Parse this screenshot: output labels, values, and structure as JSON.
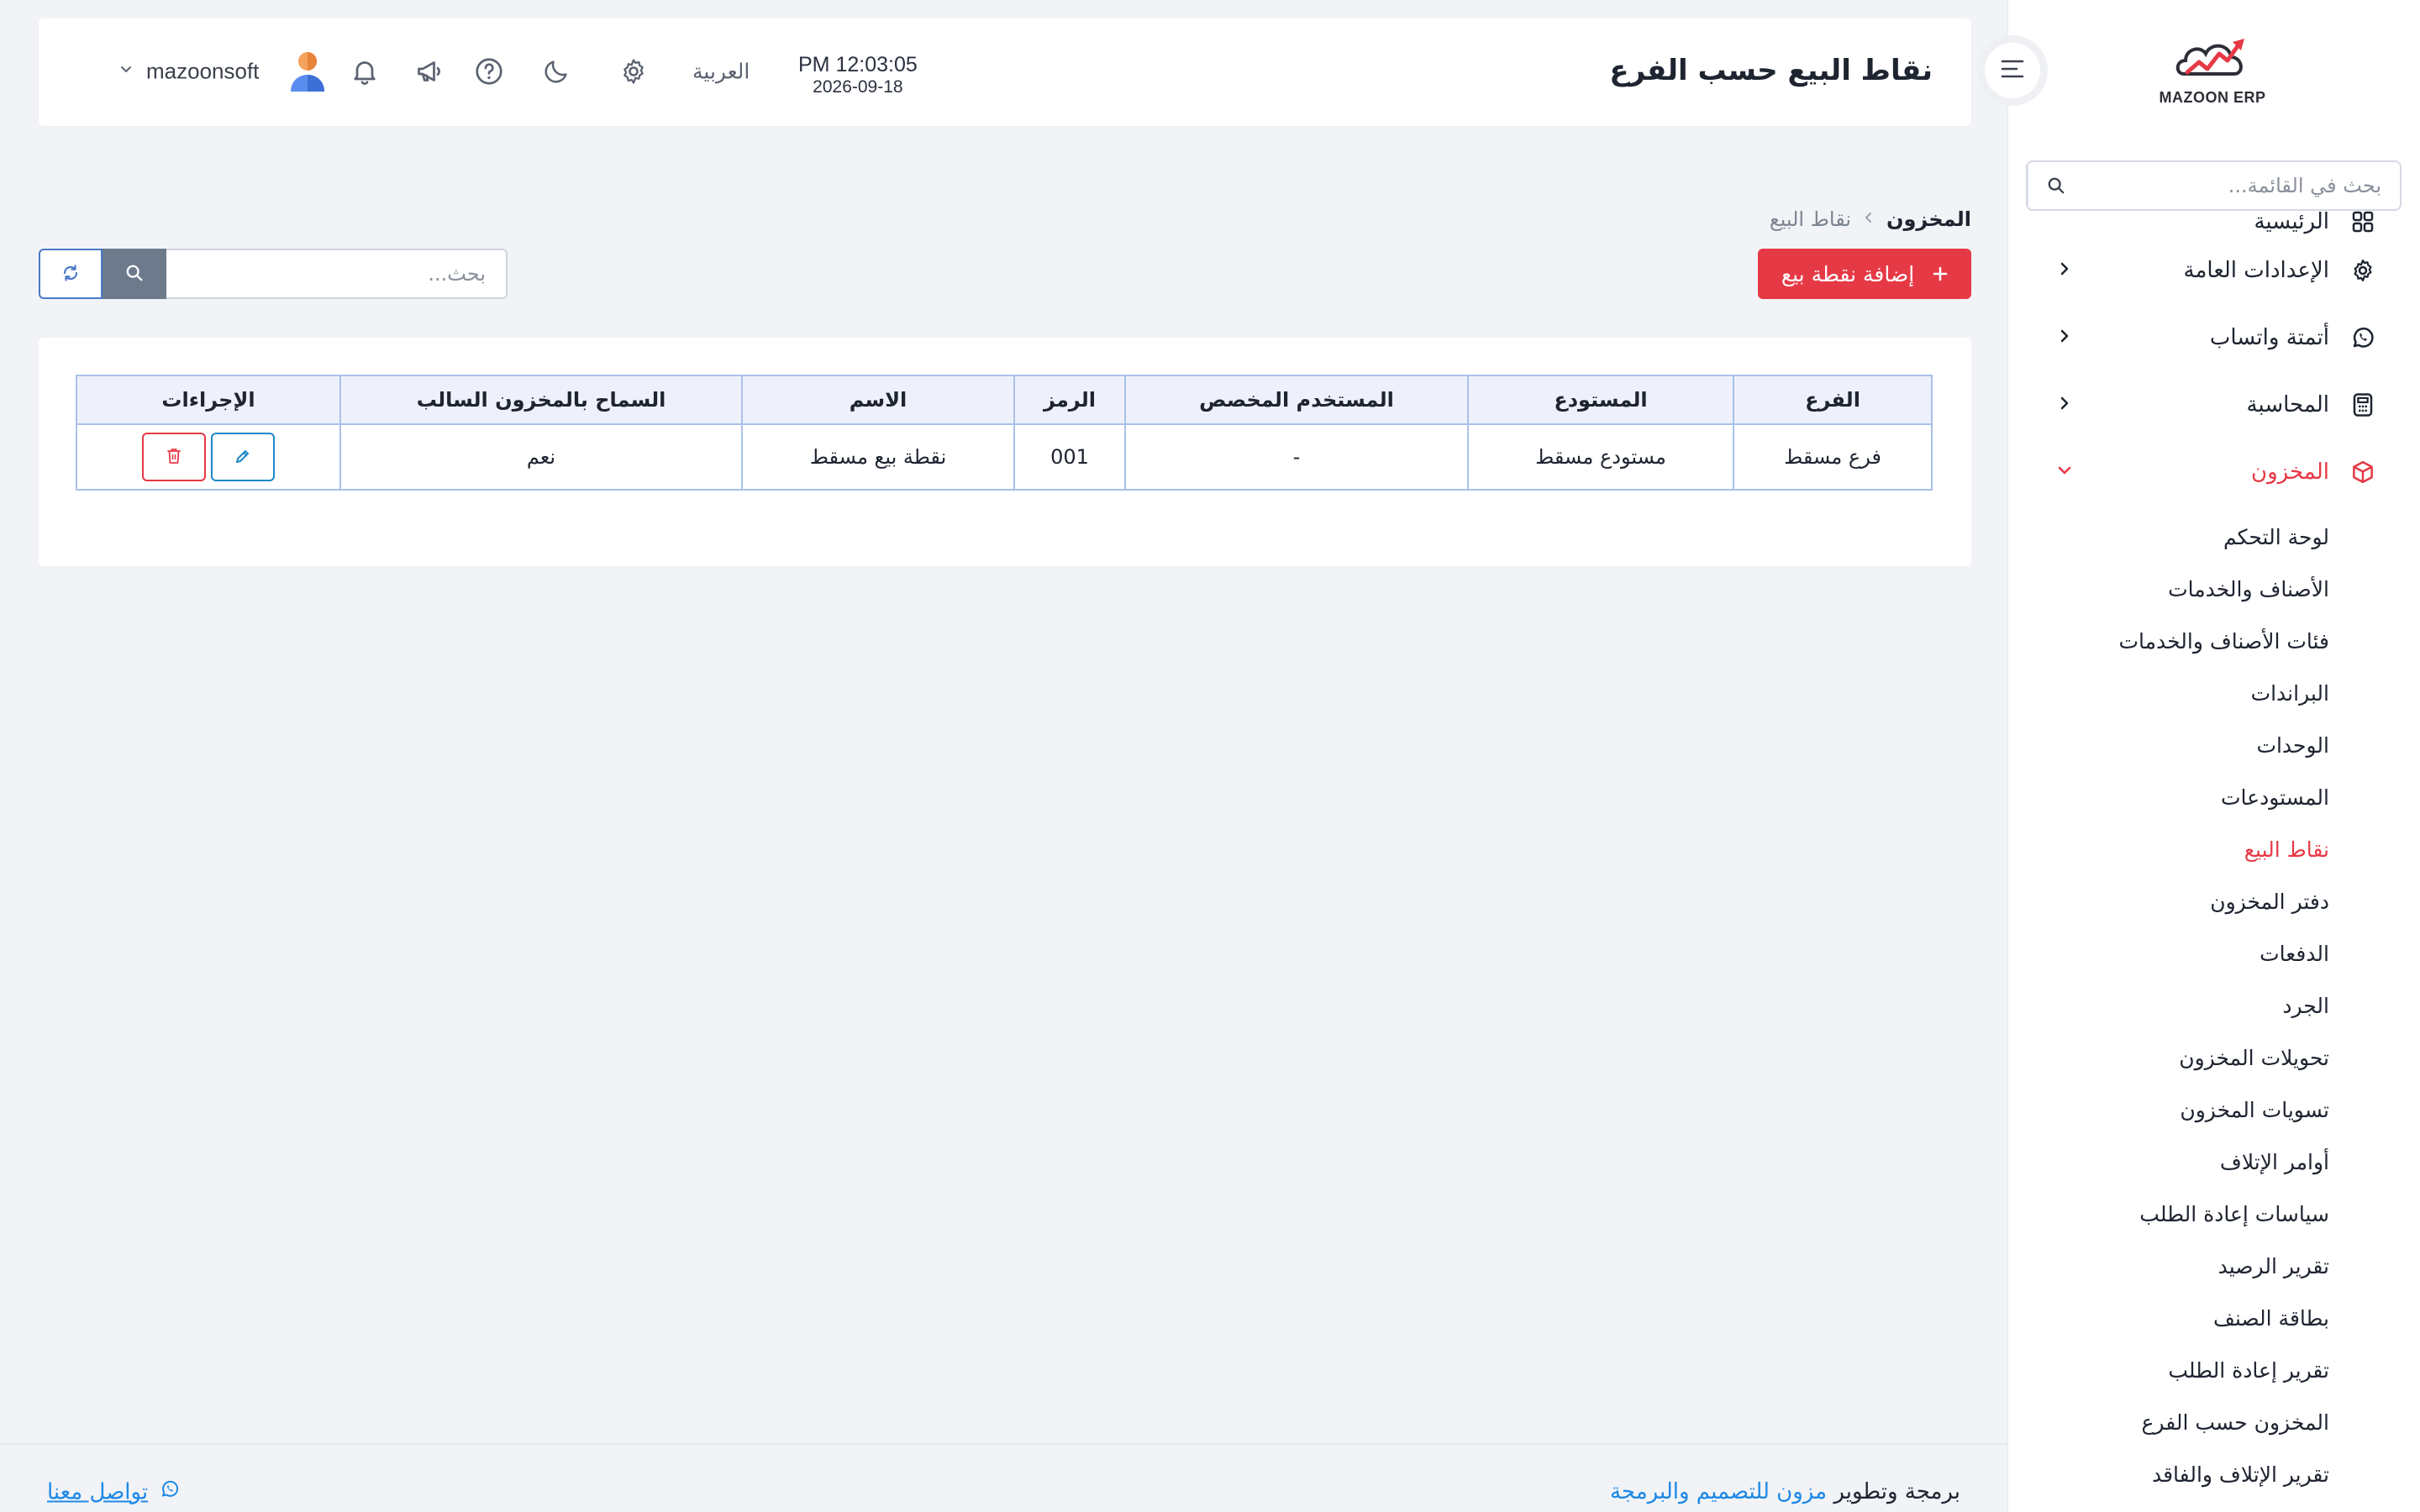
{
  "brand": {
    "logo_text": "MAZOON ERP",
    "accent": "#e63946"
  },
  "sidebar": {
    "search_placeholder": "بحث في القائمة...",
    "items": [
      {
        "label": "الرئيسية",
        "icon": "grid-icon"
      },
      {
        "label": "الإعدادات العامة",
        "icon": "gear-icon"
      },
      {
        "label": "أتمتة واتساب",
        "icon": "whatsapp-icon"
      },
      {
        "label": "المحاسبة",
        "icon": "calculator-icon"
      },
      {
        "label": "المخزون",
        "icon": "box-icon"
      }
    ],
    "inventory_sub": [
      "لوحة التحكم",
      "الأصناف والخدمات",
      "فئات الأصناف والخدمات",
      "البراندات",
      "الوحدات",
      "المستودعات",
      "نقاط البيع",
      "دفتر المخزون",
      "الدفعات",
      "الجرد",
      "تحويلات المخزون",
      "تسويات المخزون",
      "أوامر الإتلاف",
      "سياسات إعادة الطلب",
      "تقرير الرصيد",
      "بطاقة الصنف",
      "تقرير إعادة الطلب",
      "المخزون حسب الفرع",
      "تقرير الإتلاف والفاقد"
    ]
  },
  "header": {
    "title": "نقاط البيع حسب الفرع",
    "time": "PM 12:03:05",
    "date": "2026-09-18",
    "language": "العربية",
    "username": "mazoonsoft"
  },
  "breadcrumb": {
    "root": "المخزون",
    "current": "نقاط البيع"
  },
  "actions": {
    "add_label": "إضافة نقطة بيع",
    "search_placeholder": "بحث..."
  },
  "table": {
    "columns": [
      "الفرع",
      "المستودع",
      "المستخدم المخصص",
      "الرمز",
      "الاسم",
      "السماح بالمخزون السالب",
      "الإجراءات"
    ],
    "rows": [
      {
        "branch": "فرع مسقط",
        "warehouse": "مستودع مسقط",
        "user": "-",
        "code": "001",
        "name": "نقطة بيع مسقط",
        "allow_negative": "نعم"
      }
    ]
  },
  "footer": {
    "credits_prefix": "برمجة وتطوير",
    "credits_link": "مزون للتصميم والبرمجة",
    "contact": "تواصل معنا"
  }
}
